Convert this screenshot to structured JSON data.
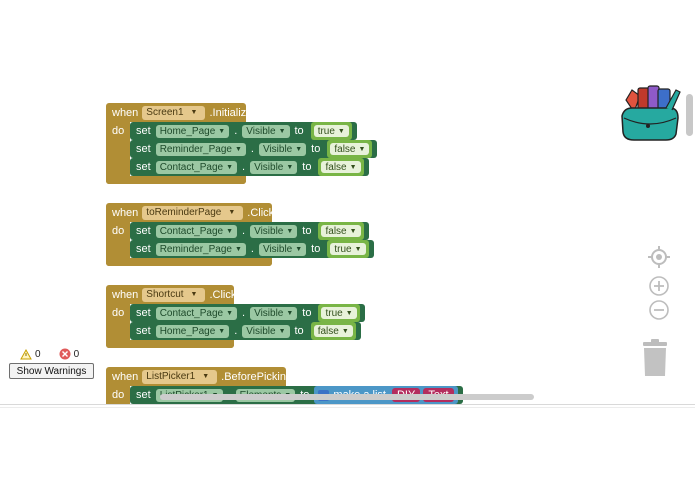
{
  "blocks": [
    {
      "when": "when",
      "component": "Screen1",
      "event": ".Initialize",
      "do": "do",
      "rows": [
        {
          "set": "set",
          "component": "Home_Page",
          "dot": ".",
          "property": "Visible",
          "to": "to",
          "value": "true"
        },
        {
          "set": "set",
          "component": "Reminder_Page",
          "dot": ".",
          "property": "Visible",
          "to": "to",
          "value": "false"
        },
        {
          "set": "set",
          "component": "Contact_Page",
          "dot": ".",
          "property": "Visible",
          "to": "to",
          "value": "false"
        }
      ]
    },
    {
      "when": "when",
      "component": "toReminderPage",
      "event": ".Click",
      "do": "do",
      "rows": [
        {
          "set": "set",
          "component": "Contact_Page",
          "dot": ".",
          "property": "Visible",
          "to": "to",
          "value": "false"
        },
        {
          "set": "set",
          "component": "Reminder_Page",
          "dot": ".",
          "property": "Visible",
          "to": "to",
          "value": "true"
        }
      ]
    },
    {
      "when": "when",
      "component": "Shortcut",
      "event": ".Click",
      "do": "do",
      "rows": [
        {
          "set": "set",
          "component": "Contact_Page",
          "dot": ".",
          "property": "Visible",
          "to": "to",
          "value": "true"
        },
        {
          "set": "set",
          "component": "Home_Page",
          "dot": ".",
          "property": "Visible",
          "to": "to",
          "value": "false"
        }
      ]
    },
    {
      "when": "when",
      "component": "ListPicker1",
      "event": ".BeforePicking",
      "do": "do",
      "rows": [
        {
          "set": "set",
          "component": "ListPicker1",
          "dot": ".",
          "property": "Elements",
          "to": "to",
          "list": "make a list",
          "item1": "DIY",
          "item2": "Text"
        }
      ]
    }
  ],
  "warnings": {
    "warning_count": "0",
    "error_count": "0",
    "button_label": "Show Warnings"
  },
  "colors": {
    "event": "#b18e35",
    "setter": "#2b6e46",
    "boolean": "#79b546",
    "list": "#4c97c7"
  }
}
